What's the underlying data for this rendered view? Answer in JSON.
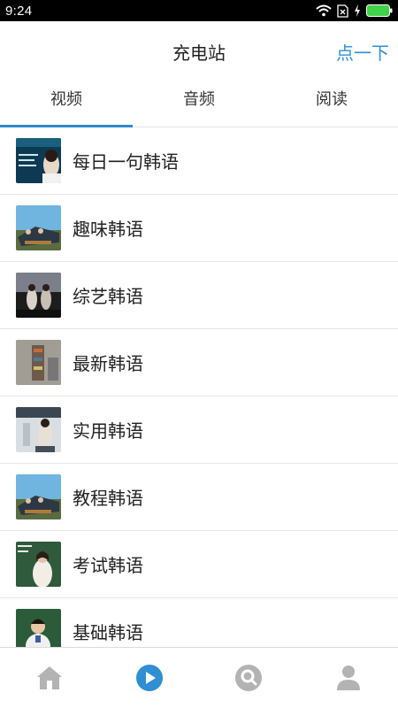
{
  "status_bar": {
    "time": "9:24"
  },
  "header": {
    "title": "充电站",
    "action": "点一下"
  },
  "tabs": [
    {
      "label": "视频",
      "active": true
    },
    {
      "label": "音频",
      "active": false
    },
    {
      "label": "阅读",
      "active": false
    }
  ],
  "list": {
    "items": [
      {
        "label": "每日一句韩语"
      },
      {
        "label": "趣味韩语"
      },
      {
        "label": "综艺韩语"
      },
      {
        "label": "最新韩语"
      },
      {
        "label": "实用韩语"
      },
      {
        "label": "教程韩语"
      },
      {
        "label": "考试韩语"
      },
      {
        "label": "基础韩语"
      }
    ]
  },
  "bottom_nav": {
    "items": [
      {
        "icon": "home-icon",
        "active": false
      },
      {
        "icon": "play-icon",
        "active": true
      },
      {
        "icon": "discover-icon",
        "active": false
      },
      {
        "icon": "profile-icon",
        "active": false
      }
    ]
  },
  "colors": {
    "accent": "#2f8fd2",
    "tab_indicator": "#3189cb",
    "inactive_icon": "#b3b3b3",
    "status_bar": "#000000",
    "battery": "#3fd24a"
  }
}
